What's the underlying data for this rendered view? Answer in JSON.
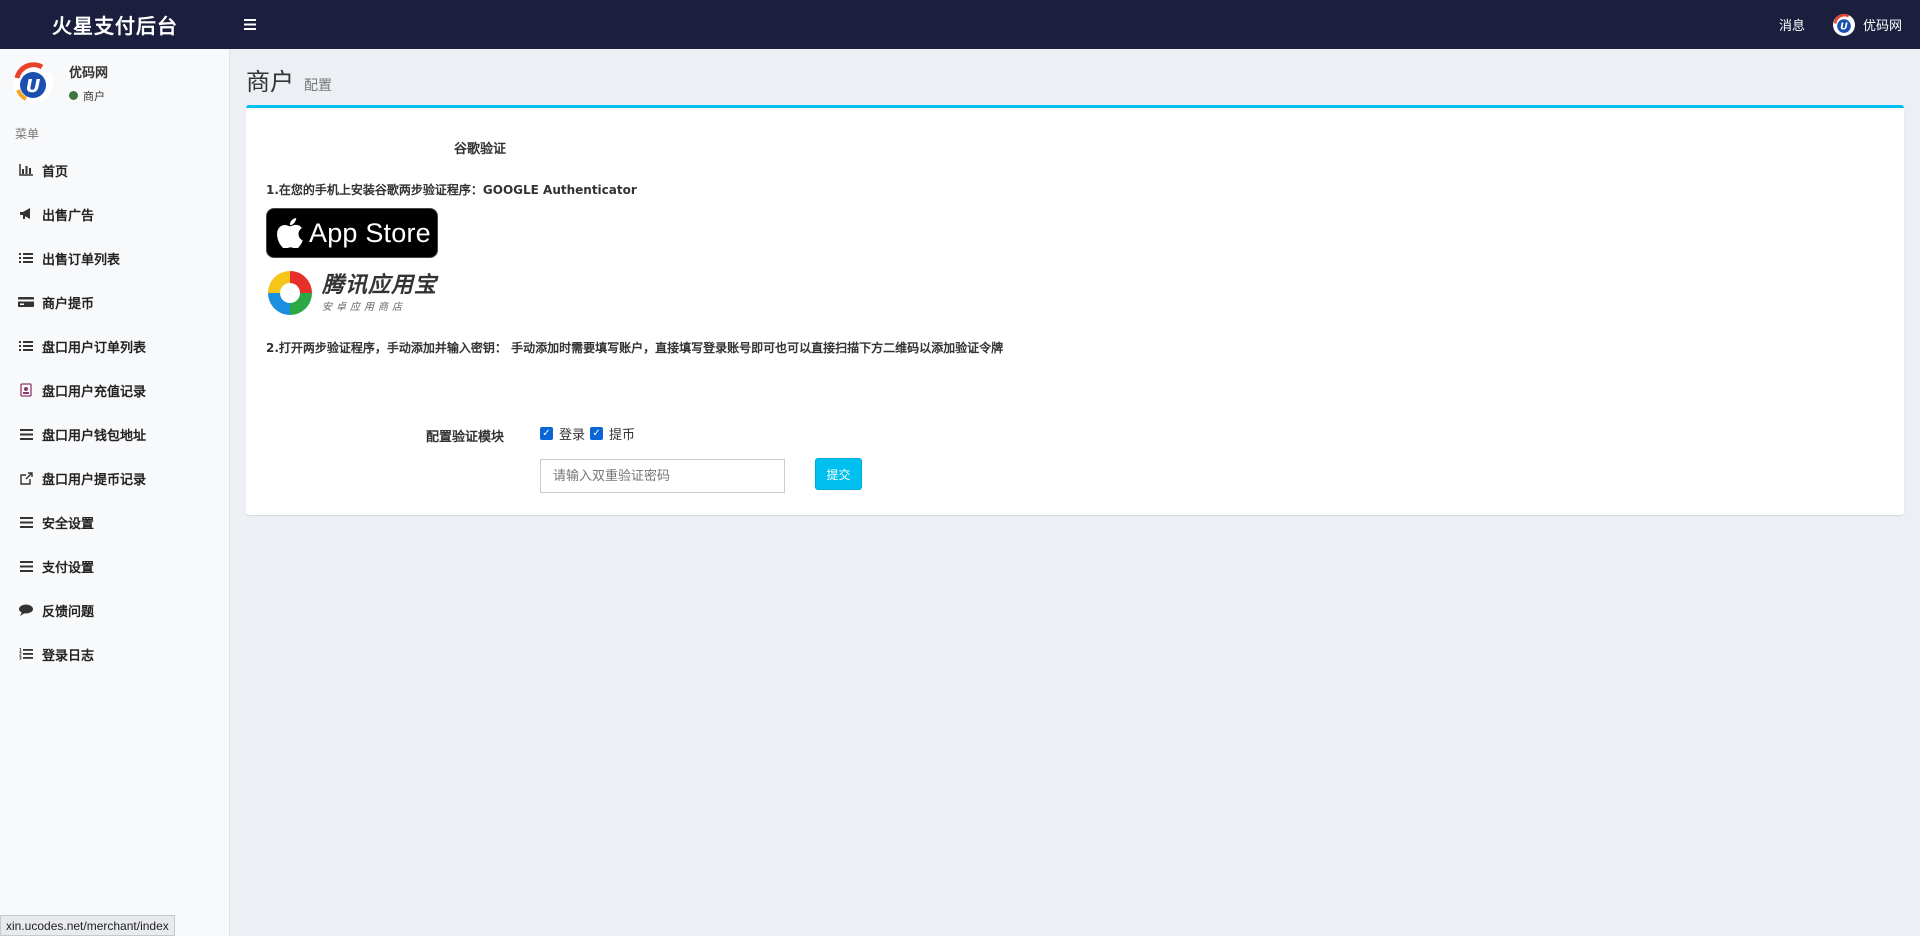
{
  "header": {
    "brand": "火星支付后台",
    "menu_icon": "bars-icon",
    "messages_label": "消息",
    "user_name": "优码网"
  },
  "sidebar": {
    "user_name": "优码网",
    "user_role": "商户",
    "status_color": "#3c763d",
    "menu_header": "菜单",
    "items": [
      {
        "label": "首页",
        "icon": "bar-chart-icon"
      },
      {
        "label": "出售广告",
        "icon": "bullhorn-icon"
      },
      {
        "label": "出售订单列表",
        "icon": "list-icon"
      },
      {
        "label": "商户提币",
        "icon": "credit-card-icon"
      },
      {
        "label": "盘口用户订单列表",
        "icon": "list-icon"
      },
      {
        "label": "盘口用户充值记录",
        "icon": "id-badge-icon"
      },
      {
        "label": "盘口用户钱包地址",
        "icon": "bars-icon"
      },
      {
        "label": "盘口用户提币记录",
        "icon": "external-link-icon"
      },
      {
        "label": "安全设置",
        "icon": "bars-icon"
      },
      {
        "label": "支付设置",
        "icon": "bars-icon"
      },
      {
        "label": "反馈问题",
        "icon": "comment-icon"
      },
      {
        "label": "登录日志",
        "icon": "list-ol-icon"
      }
    ]
  },
  "content": {
    "title": "商户",
    "subtitle": "配置",
    "google_label": "谷歌验证",
    "step1": "1.在您的手机上安装谷歌两步验证程序：GOOGLE Authenticator",
    "appstore_label": "App Store",
    "tencent_main": "腾讯应用宝",
    "tencent_sub": "安卓应用商店",
    "step2": "2.打开两步验证程序，手动添加并输入密钥： 手动添加时需要填写账户，直接填写登录账号即可也可以直接扫描下方二维码以添加验证令牌",
    "config_label": "配置验证模块",
    "check_login": "登录",
    "check_withdraw": "提币",
    "otp_placeholder": "请输入双重验证密码",
    "submit_label": "提交"
  },
  "status_url": "xin.ucodes.net/merchant/index",
  "colors": {
    "topbar": "#1b1e3d",
    "accent": "#00c0ef",
    "background": "#ecf0f5"
  }
}
